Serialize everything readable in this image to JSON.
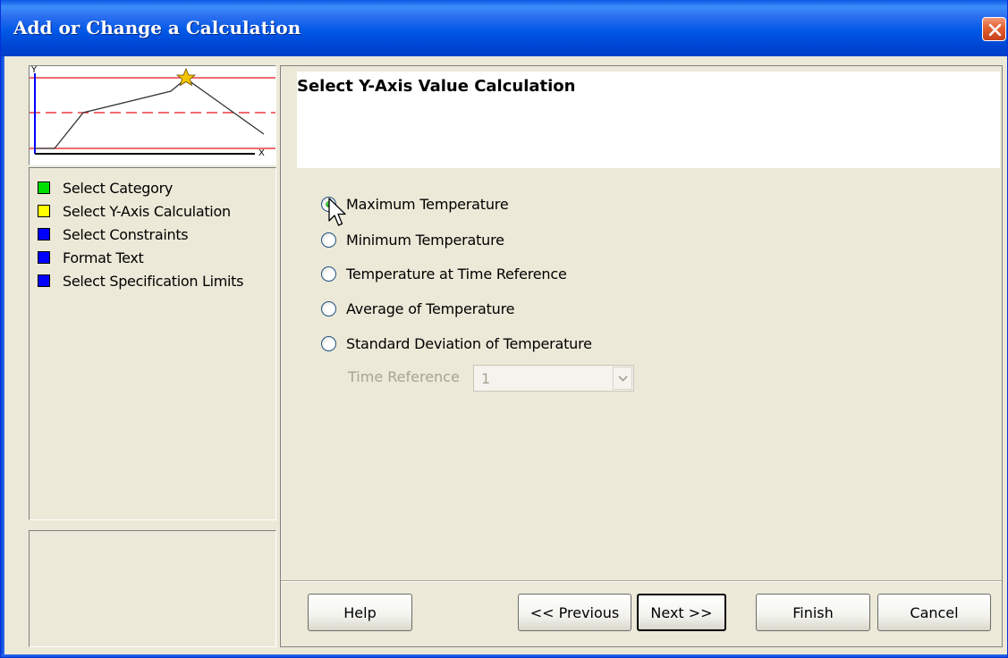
{
  "window": {
    "title": "Add or Change a Calculation",
    "close_label": "close"
  },
  "preview": {
    "y_label": "Y",
    "x_label": "X"
  },
  "steps": [
    {
      "label": "Select Category",
      "color": "#00e000"
    },
    {
      "label": "Select Y-Axis Calculation",
      "color": "#ffff00"
    },
    {
      "label": "Select Constraints",
      "color": "#0000ff"
    },
    {
      "label": "Format Text",
      "color": "#0000ff"
    },
    {
      "label": "Select Specification Limits",
      "color": "#0000ff"
    }
  ],
  "main": {
    "heading": "Select Y-Axis Value Calculation",
    "options": [
      {
        "label": "Maximum Temperature",
        "checked": true
      },
      {
        "label": "Minimum Temperature",
        "checked": false
      },
      {
        "label": "Temperature at Time Reference",
        "checked": false
      },
      {
        "label": "Average of Temperature",
        "checked": false
      },
      {
        "label": "Standard Deviation of Temperature",
        "checked": false
      }
    ],
    "time_reference": {
      "label": "Time Reference",
      "value": "1",
      "enabled": false
    }
  },
  "buttons": {
    "help": "Help",
    "previous": "<< Previous",
    "next": "Next >>",
    "finish": "Finish",
    "cancel": "Cancel"
  },
  "icons": {
    "close": "close-icon",
    "star": "star-icon",
    "dropdown": "chevron-down-icon",
    "cursor": "mouse-pointer-icon"
  }
}
